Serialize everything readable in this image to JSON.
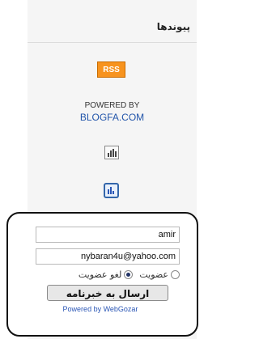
{
  "links": {
    "title": "پیوندها"
  },
  "rss": {
    "label": "RSS"
  },
  "powered": {
    "label": "POWERED BY",
    "link": "BLOGFA.COM"
  },
  "newsletter": {
    "name_value": "amir",
    "email_value": "nybaran4u@yahoo.com",
    "radio_join": "عضویت",
    "radio_leave": "لغو عضویت",
    "submit_label": "ارسال به خبرنامه",
    "footer_link": "Powered by WebGozar"
  }
}
